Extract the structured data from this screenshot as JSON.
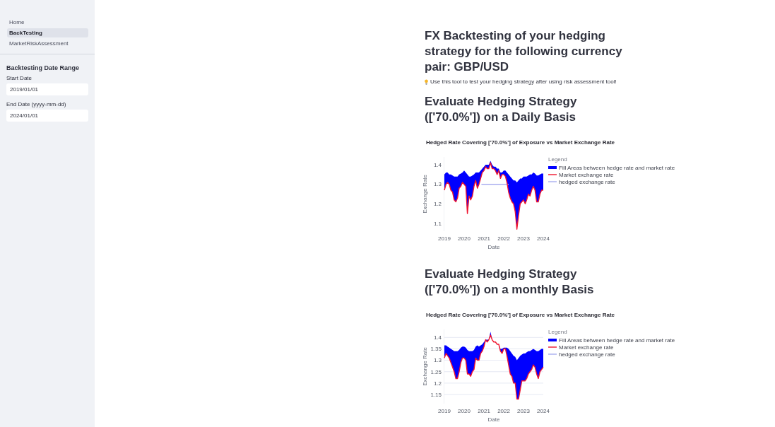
{
  "sidebar": {
    "nav": [
      {
        "label": "Home",
        "selected": false
      },
      {
        "label": "BackTesting",
        "selected": true
      },
      {
        "label": "MarketRiskAssessment",
        "selected": false
      }
    ],
    "section_title": "Backtesting Date Range",
    "date_fields": [
      {
        "label": "Start Date",
        "value": "2019/01/01"
      },
      {
        "label": "End Date (yyyy-mm-dd)",
        "value": "2024/01/01"
      }
    ]
  },
  "main": {
    "title": "FX Backtesting of your hedging strategy for the following currency pair: GBP/USD",
    "caption": "Use this tool to test your hedging strategy after using risk assessment tool!",
    "sections": [
      {
        "heading": "Evaluate Hedging Strategy (['70.0%']) on a Daily Basis",
        "chart_data": {
          "type": "line",
          "title": "Hedged Rate Covering ['70.0%'] of Exposure vs Market Exchange Rate",
          "xlabel": "Date",
          "ylabel": "Exchange Rate",
          "legend_title": "Legend",
          "legend": "right",
          "xlim": [
            "2019-01-01",
            "2024-01-01"
          ],
          "ylim": [
            1.06,
            1.44
          ],
          "yticks": [
            1.1,
            1.2,
            1.3,
            1.4
          ],
          "xticks": [
            {
              "value": "2019-01-01",
              "label": "2019"
            },
            {
              "value": "2020-01-01",
              "label": "2020"
            },
            {
              "value": "2021-01-01",
              "label": "2021"
            },
            {
              "value": "2022-01-01",
              "label": "2022"
            },
            {
              "value": "2023-01-01",
              "label": "2023"
            },
            {
              "value": "2024-01-01",
              "label": "2024"
            }
          ],
          "x": [
            "2019-01-01",
            "2019-02-01",
            "2019-03-01",
            "2019-04-01",
            "2019-05-01",
            "2019-06-01",
            "2019-07-01",
            "2019-08-01",
            "2019-09-01",
            "2019-10-01",
            "2019-11-01",
            "2019-12-01",
            "2020-01-01",
            "2020-02-01",
            "2020-03-01",
            "2020-04-01",
            "2020-05-01",
            "2020-06-01",
            "2020-07-01",
            "2020-08-01",
            "2020-09-01",
            "2020-10-01",
            "2020-11-01",
            "2020-12-01",
            "2021-01-01",
            "2021-02-01",
            "2021-03-01",
            "2021-04-01",
            "2021-05-01",
            "2021-06-01",
            "2021-07-01",
            "2021-08-01",
            "2021-09-01",
            "2021-10-01",
            "2021-11-01",
            "2021-12-01",
            "2022-01-01",
            "2022-02-01",
            "2022-03-01",
            "2022-04-01",
            "2022-05-01",
            "2022-06-01",
            "2022-07-01",
            "2022-08-01",
            "2022-09-01",
            "2022-10-01",
            "2022-11-01",
            "2022-12-01",
            "2023-01-01",
            "2023-02-01",
            "2023-03-01",
            "2023-04-01",
            "2023-05-01",
            "2023-06-01",
            "2023-07-01",
            "2023-08-01",
            "2023-09-01",
            "2023-10-01",
            "2023-11-01",
            "2023-12-01",
            "2024-01-01"
          ],
          "series": [
            {
              "name": "Fill Areas between hedge rate and market rate",
              "type": "area",
              "color": "#0000ff",
              "values": [
                1.35,
                1.36,
                1.36,
                1.35,
                1.35,
                1.345,
                1.34,
                1.34,
                1.34,
                1.35,
                1.355,
                1.36,
                1.37,
                1.36,
                1.35,
                1.34,
                1.34,
                1.345,
                1.35,
                1.36,
                1.36,
                1.36,
                1.37,
                1.38,
                1.39,
                1.4,
                1.4,
                1.4,
                1.42,
                1.4,
                1.39,
                1.39,
                1.38,
                1.38,
                1.36,
                1.36,
                1.37,
                1.37,
                1.36,
                1.35,
                1.34,
                1.33,
                1.32,
                1.32,
                1.31,
                1.32,
                1.33,
                1.33,
                1.34,
                1.34,
                1.34,
                1.345,
                1.35,
                1.35,
                1.36,
                1.355,
                1.345,
                1.345,
                1.35,
                1.355,
                1.355
              ]
            },
            {
              "name": "Market exchange rate",
              "type": "line",
              "color": "#f0142e",
              "values": [
                1.27,
                1.3,
                1.31,
                1.3,
                1.27,
                1.26,
                1.22,
                1.21,
                1.23,
                1.28,
                1.29,
                1.31,
                1.3,
                1.29,
                1.15,
                1.24,
                1.22,
                1.24,
                1.29,
                1.32,
                1.28,
                1.3,
                1.33,
                1.36,
                1.37,
                1.39,
                1.38,
                1.38,
                1.41,
                1.38,
                1.38,
                1.37,
                1.35,
                1.37,
                1.33,
                1.35,
                1.35,
                1.34,
                1.31,
                1.26,
                1.23,
                1.21,
                1.2,
                1.16,
                1.07,
                1.14,
                1.2,
                1.21,
                1.22,
                1.2,
                1.22,
                1.25,
                1.24,
                1.27,
                1.29,
                1.27,
                1.21,
                1.21,
                1.25,
                1.27,
                1.27
              ]
            },
            {
              "name": "hedged exchange rate",
              "type": "line",
              "color": "#a9aef0",
              "x": [
                "2020-11-15",
                "2022-04-01"
              ],
              "values": [
                1.3,
                1.3
              ]
            }
          ]
        }
      },
      {
        "heading": "Evaluate Hedging Strategy (['70.0%']) on a monthly Basis",
        "chart_data": {
          "type": "line",
          "title": "Hedged Rate Covering ['70.0%'] of Exposure vs Market Exchange Rate",
          "xlabel": "Date",
          "ylabel": "Exchange Rate",
          "legend_title": "Legend",
          "legend": "right",
          "grid": true,
          "xlim": [
            "2019-01-01",
            "2024-01-01"
          ],
          "ylim": [
            1.11,
            1.435
          ],
          "yticks": [
            1.15,
            1.2,
            1.25,
            1.3,
            1.35,
            1.4
          ],
          "xticks": [
            {
              "value": "2019-01-01",
              "label": "2019"
            },
            {
              "value": "2020-01-01",
              "label": "2020"
            },
            {
              "value": "2021-01-01",
              "label": "2021"
            },
            {
              "value": "2022-01-01",
              "label": "2022"
            },
            {
              "value": "2023-01-01",
              "label": "2023"
            },
            {
              "value": "2024-01-01",
              "label": "2024"
            }
          ],
          "x": [
            "2019-01-01",
            "2019-02-01",
            "2019-03-01",
            "2019-04-01",
            "2019-05-01",
            "2019-06-01",
            "2019-07-01",
            "2019-08-01",
            "2019-09-01",
            "2019-10-01",
            "2019-11-01",
            "2019-12-01",
            "2020-01-01",
            "2020-02-01",
            "2020-03-01",
            "2020-04-01",
            "2020-05-01",
            "2020-06-01",
            "2020-07-01",
            "2020-08-01",
            "2020-09-01",
            "2020-10-01",
            "2020-11-01",
            "2020-12-01",
            "2021-01-01",
            "2021-02-01",
            "2021-03-01",
            "2021-04-01",
            "2021-05-01",
            "2021-06-01",
            "2021-07-01",
            "2021-08-01",
            "2021-09-01",
            "2021-10-01",
            "2021-11-01",
            "2021-12-01",
            "2022-01-01",
            "2022-02-01",
            "2022-03-01",
            "2022-04-01",
            "2022-05-01",
            "2022-06-01",
            "2022-07-01",
            "2022-08-01",
            "2022-09-01",
            "2022-10-01",
            "2022-11-01",
            "2022-12-01",
            "2023-01-01",
            "2023-02-01",
            "2023-03-01",
            "2023-04-01",
            "2023-05-01",
            "2023-06-01",
            "2023-07-01",
            "2023-08-01",
            "2023-09-01",
            "2023-10-01",
            "2023-11-01",
            "2023-12-01",
            "2024-01-01"
          ],
          "series": [
            {
              "name": "Fill Areas between hedge rate and market rate",
              "type": "area",
              "color": "#0000ff",
              "values": [
                1.365,
                1.365,
                1.36,
                1.355,
                1.35,
                1.345,
                1.34,
                1.34,
                1.34,
                1.345,
                1.355,
                1.36,
                1.36,
                1.355,
                1.345,
                1.34,
                1.34,
                1.34,
                1.345,
                1.36,
                1.365,
                1.36,
                1.365,
                1.37,
                1.38,
                1.39,
                1.39,
                1.39,
                1.425,
                1.39,
                1.38,
                1.38,
                1.37,
                1.37,
                1.35,
                1.35,
                1.355,
                1.355,
                1.355,
                1.35,
                1.34,
                1.33,
                1.32,
                1.315,
                1.3,
                1.31,
                1.32,
                1.325,
                1.33,
                1.33,
                1.335,
                1.34,
                1.34,
                1.345,
                1.35,
                1.345,
                1.34,
                1.34,
                1.345,
                1.35,
                1.35
              ]
            },
            {
              "name": "Market exchange rate",
              "type": "line",
              "color": "#f0142e",
              "values": [
                1.31,
                1.33,
                1.32,
                1.31,
                1.29,
                1.27,
                1.25,
                1.22,
                1.22,
                1.25,
                1.29,
                1.31,
                1.31,
                1.3,
                1.24,
                1.24,
                1.23,
                1.25,
                1.26,
                1.31,
                1.3,
                1.3,
                1.33,
                1.34,
                1.36,
                1.39,
                1.38,
                1.39,
                1.41,
                1.39,
                1.38,
                1.38,
                1.37,
                1.37,
                1.34,
                1.33,
                1.35,
                1.35,
                1.32,
                1.28,
                1.24,
                1.23,
                1.2,
                1.2,
                1.13,
                1.13,
                1.17,
                1.21,
                1.21,
                1.21,
                1.22,
                1.24,
                1.25,
                1.26,
                1.28,
                1.27,
                1.24,
                1.22,
                1.25,
                1.26,
                1.27
              ]
            },
            {
              "name": "hedged exchange rate",
              "type": "line",
              "color": "#a9aef0",
              "values": [
                null,
                null,
                null,
                null,
                null,
                null,
                null,
                null,
                null,
                null,
                null,
                null,
                null,
                null,
                null,
                null,
                null,
                null,
                null,
                null,
                null,
                null,
                null,
                null,
                null,
                null,
                null,
                null,
                null,
                null,
                null,
                null,
                null,
                null,
                null,
                null,
                null,
                null,
                null,
                null,
                null,
                null,
                null,
                null,
                null,
                null,
                null,
                null,
                null,
                null,
                null,
                null,
                null,
                null,
                null,
                null,
                null,
                null,
                null,
                null,
                null
              ]
            }
          ]
        }
      }
    ]
  }
}
